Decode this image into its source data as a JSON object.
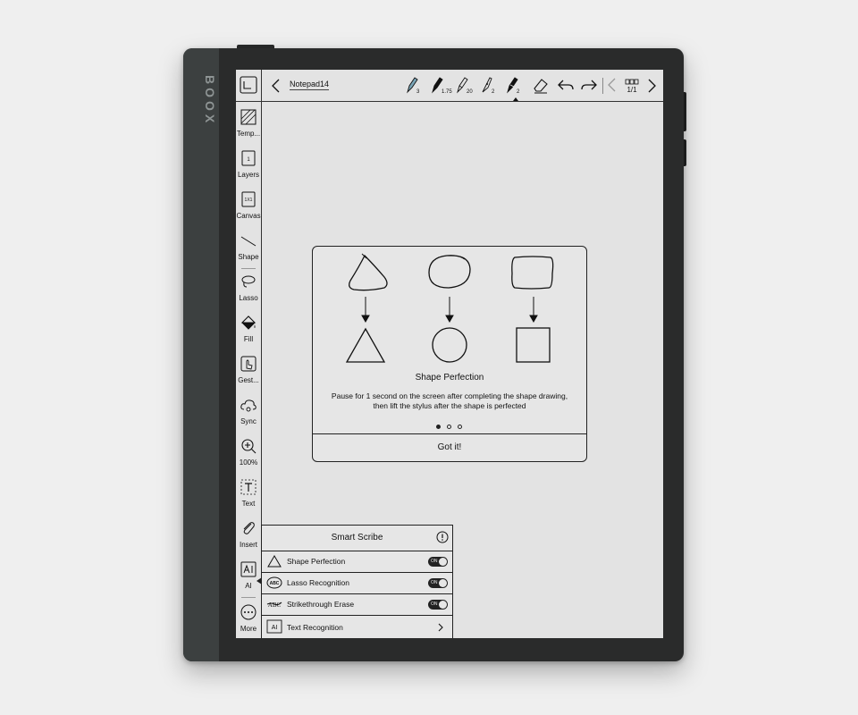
{
  "device": {
    "brand": "BOOX"
  },
  "toolbar": {
    "title": "Notepad14",
    "pens": [
      {
        "name": "highlighter",
        "value": "3"
      },
      {
        "name": "fountain-pen",
        "value": "1.75"
      },
      {
        "name": "pencil",
        "value": "20"
      },
      {
        "name": "brush",
        "value": "2"
      },
      {
        "name": "marker",
        "value": "2"
      }
    ],
    "page": "1/1"
  },
  "sidebar": {
    "items": [
      {
        "label": "Temp..."
      },
      {
        "label": "Layers"
      },
      {
        "label": "Canvas"
      },
      {
        "label": "Shape"
      },
      {
        "label": "Lasso"
      },
      {
        "label": "Fill"
      },
      {
        "label": "Gest..."
      },
      {
        "label": "Sync"
      },
      {
        "label": "100%"
      },
      {
        "label": "Text"
      },
      {
        "label": "Insert"
      },
      {
        "label": "AI"
      },
      {
        "label": "More"
      }
    ],
    "layers_icon_text": "1",
    "canvas_icon_text": "1X1"
  },
  "dialog": {
    "title": "Shape Perfection",
    "body": "Pause for 1 second on the screen after completing the shape drawing, then lift the stylus after the shape is perfected",
    "page_dots": 3,
    "active_dot": 1,
    "button": "Got it!"
  },
  "smart_scribe": {
    "title": "Smart Scribe",
    "rows": [
      {
        "label": "Shape Perfection",
        "toggle": "ON"
      },
      {
        "label": "Lasso Recognition",
        "toggle": "ON"
      },
      {
        "label": "Strikethrough Erase",
        "toggle": "ON"
      },
      {
        "label": "Text Recognition"
      }
    ],
    "lasso_icon_text": "ABC",
    "strike_icon_text": "ABC",
    "text_icon_text": "AI"
  }
}
